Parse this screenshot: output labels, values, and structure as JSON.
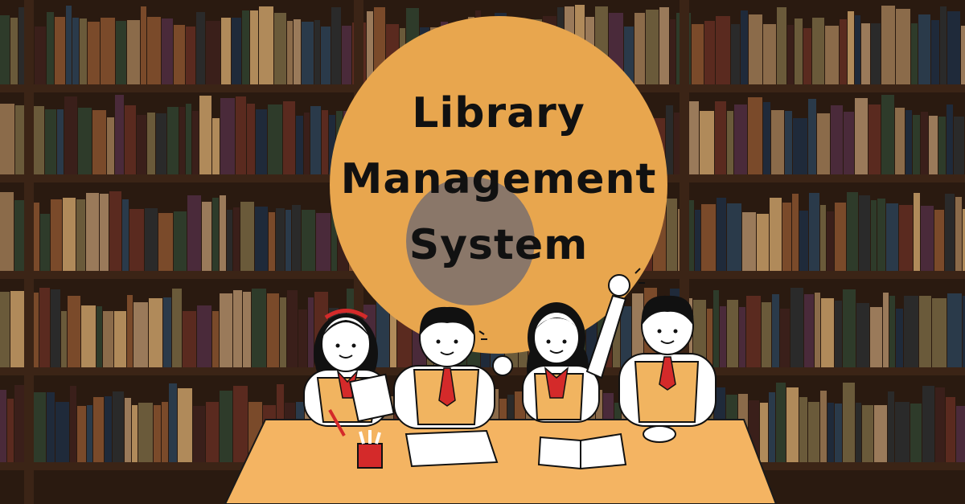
{
  "title": {
    "line1": "Library",
    "line2": "Management",
    "line3": "System"
  },
  "colors": {
    "circle": "#e8a64e",
    "inner_circle": "#8a7769",
    "desk": "#f4b462",
    "vest": "#f1b460",
    "tie": "#d42a2a",
    "shelf": "#3b2416",
    "background": "#2a1a10"
  },
  "illustration": {
    "scene": "library-bookshelves",
    "figures": [
      "student-girl-writing",
      "student-boy-reading",
      "student-girl-raising-hand",
      "student-boy-smiling"
    ],
    "desk_items": [
      "pencil-cup-icon",
      "paper-sheet-icon",
      "open-book-icon"
    ]
  }
}
